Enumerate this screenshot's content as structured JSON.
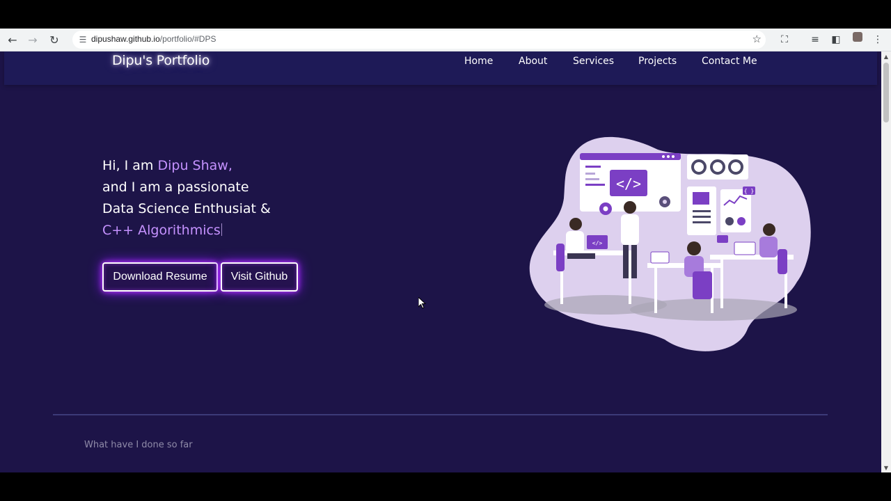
{
  "browser": {
    "url_host": "dipushaw.github.io",
    "url_path": "/portfolio/#DPS",
    "icons": [
      "back-arrow-icon",
      "forward-arrow-icon",
      "reload-icon",
      "site-info-icon",
      "bookmark-star-icon",
      "extensions-icon",
      "reading-list-icon",
      "side-panel-icon",
      "profile-avatar-icon",
      "kebab-menu-icon"
    ]
  },
  "navbar": {
    "brand": "Dipu's Portfolio",
    "links": [
      "Home",
      "About",
      "Services",
      "Projects",
      "Contact Me"
    ]
  },
  "hero": {
    "greeting_prefix": "Hi, I am ",
    "name": "Dipu Shaw,",
    "line2": "and I am a passionate",
    "line3": "Data Science Enthusiat &",
    "typed_text": "C++ Algorithmics",
    "buttons": {
      "resume": "Download Resume",
      "github": "Visit Github"
    },
    "illustration_code": "</>",
    "illustration_badge_a": "</>",
    "illustration_badge_b": "{ }"
  },
  "section": {
    "subtitle": "What have I done so far"
  },
  "colors": {
    "page_bg": "#1d1448",
    "navbar_bg": "#1e1a57",
    "accent": "#c592ff",
    "button_glow": "#c03bff",
    "illustration_purple": "#7b3fc4",
    "illustration_lilac": "#ddd0ee"
  }
}
